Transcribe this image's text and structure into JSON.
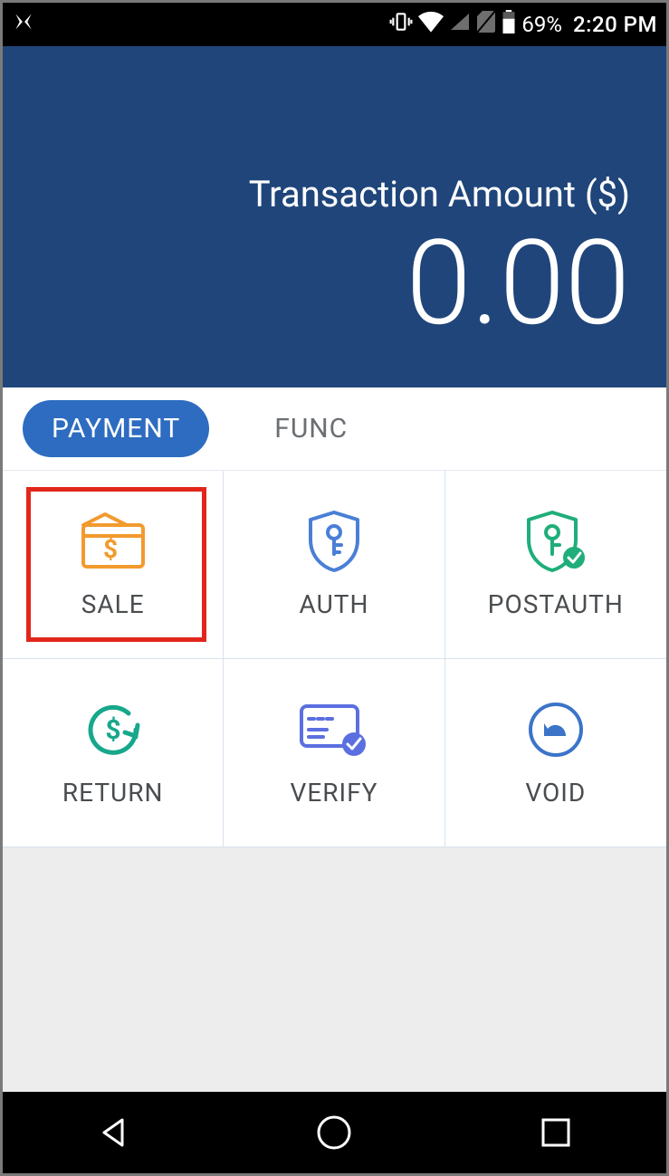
{
  "status": {
    "battery_pct": "69%",
    "time": "2:20 PM"
  },
  "header": {
    "label": "Transaction Amount ($)",
    "amount": "0.00"
  },
  "tabs": {
    "payment": "PAYMENT",
    "func": "FUNC"
  },
  "cells": {
    "sale": "SALE",
    "auth": "AUTH",
    "postauth": "POSTAUTH",
    "return": "RETURN",
    "verify": "VERIFY",
    "void": "VOID"
  },
  "colors": {
    "header_bg": "#1f457a",
    "tab_active": "#2d6cc0",
    "highlight": "#e1261c",
    "sale_icon": "#f29a2e",
    "auth_icon": "#4a7fd6",
    "postauth_icon": "#1fae7a",
    "return_icon": "#17a88b",
    "verify_icon": "#5b6fe0",
    "void_icon": "#3b74c8"
  }
}
